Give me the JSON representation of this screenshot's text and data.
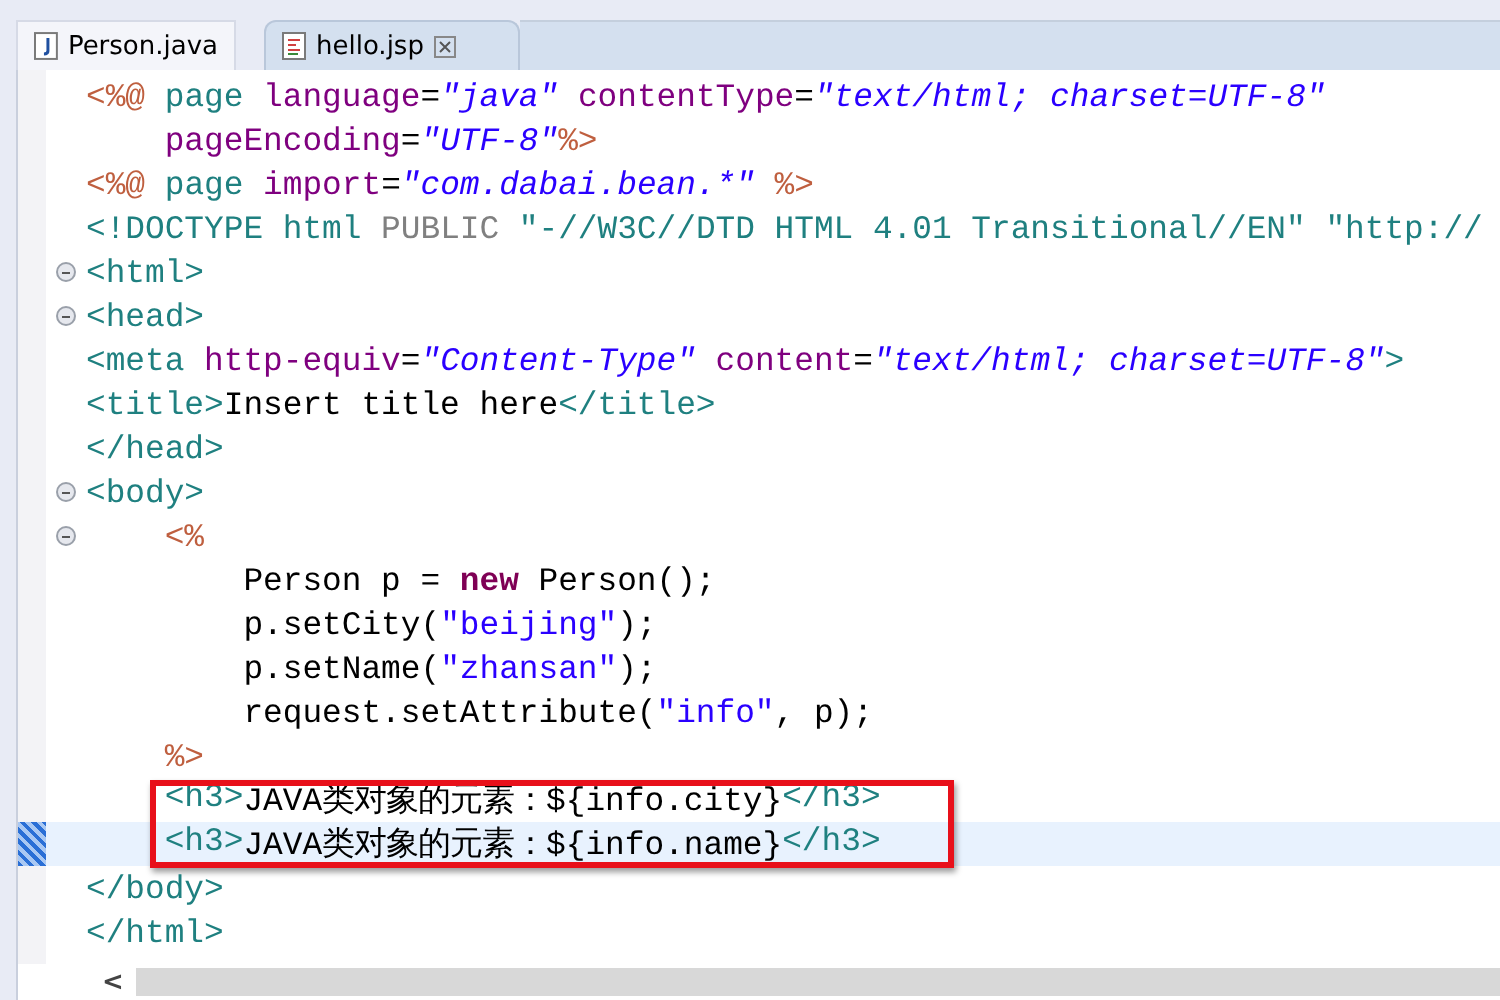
{
  "tabs": [
    {
      "label": "Person.java",
      "kind": "java",
      "selected": false,
      "closable": false
    },
    {
      "label": "hello.jsp",
      "kind": "jsp",
      "selected": true,
      "closable": true
    }
  ],
  "blocks": [
    {
      "boxed": false,
      "lines": [
        {
          "fold_marker": false,
          "current": false,
          "tokens": [
            {
              "kind": "jsp",
              "text": "<%@"
            },
            {
              "kind": "tag",
              "text": " page"
            },
            {
              "kind": "attr",
              "text": " language"
            },
            {
              "kind": "punct",
              "text": "="
            },
            {
              "kind": "value",
              "text": "\"java\""
            },
            {
              "kind": "attr",
              "text": " contentType"
            },
            {
              "kind": "punct",
              "text": "="
            },
            {
              "kind": "value",
              "text": "\"text/html; charset=UTF-8\""
            }
          ]
        },
        {
          "fold_marker": false,
          "current": false,
          "tokens": [
            {
              "kind": "attr",
              "text": "    pageEncoding"
            },
            {
              "kind": "punct",
              "text": "="
            },
            {
              "kind": "value",
              "text": "\"UTF-8\""
            },
            {
              "kind": "jsp",
              "text": "%>"
            }
          ]
        },
        {
          "fold_marker": false,
          "current": false,
          "tokens": [
            {
              "kind": "jsp",
              "text": "<%@"
            },
            {
              "kind": "tag",
              "text": " page"
            },
            {
              "kind": "attr",
              "text": " import"
            },
            {
              "kind": "punct",
              "text": "="
            },
            {
              "kind": "value",
              "text": "\"com.dabai.bean.*\""
            },
            {
              "kind": "jsp",
              "text": " %>"
            }
          ]
        },
        {
          "fold_marker": false,
          "current": false,
          "tokens": [
            {
              "kind": "tag",
              "text": "<!DOCTYPE html"
            },
            {
              "kind": "doctype",
              "text": " PUBLIC"
            },
            {
              "kind": "tag",
              "text": " \"-//W3C//DTD HTML 4.01 Transitional//EN\" \"http://"
            }
          ]
        },
        {
          "fold_marker": true,
          "current": false,
          "tokens": [
            {
              "kind": "tag",
              "text": "<html>"
            }
          ]
        },
        {
          "fold_marker": true,
          "current": false,
          "tokens": [
            {
              "kind": "tag",
              "text": "<head>"
            }
          ]
        },
        {
          "fold_marker": false,
          "current": false,
          "tokens": [
            {
              "kind": "tag",
              "text": "<meta"
            },
            {
              "kind": "attr",
              "text": " http-equiv"
            },
            {
              "kind": "punct",
              "text": "="
            },
            {
              "kind": "value",
              "text": "\"Content-Type\""
            },
            {
              "kind": "attr",
              "text": " content"
            },
            {
              "kind": "punct",
              "text": "="
            },
            {
              "kind": "value",
              "text": "\"text/html; charset=UTF-8\""
            },
            {
              "kind": "tag",
              "text": ">"
            }
          ]
        },
        {
          "fold_marker": false,
          "current": false,
          "tokens": [
            {
              "kind": "tag",
              "text": "<title>"
            },
            {
              "kind": "text",
              "text": "Insert title here"
            },
            {
              "kind": "tag",
              "text": "</title>"
            }
          ]
        },
        {
          "fold_marker": false,
          "current": false,
          "tokens": [
            {
              "kind": "tag",
              "text": "</head>"
            }
          ]
        },
        {
          "fold_marker": true,
          "current": false,
          "tokens": [
            {
              "kind": "tag",
              "text": "<body>"
            }
          ]
        },
        {
          "fold_marker": true,
          "current": false,
          "tokens": [
            {
              "kind": "jsp",
              "text": "    <%"
            }
          ]
        },
        {
          "fold_marker": false,
          "current": false,
          "tokens": [
            {
              "kind": "text",
              "text": "        Person p = "
            },
            {
              "kind": "keyword",
              "text": "new"
            },
            {
              "kind": "text",
              "text": " Person();"
            }
          ]
        },
        {
          "fold_marker": false,
          "current": false,
          "tokens": [
            {
              "kind": "text",
              "text": "        p.setCity("
            },
            {
              "kind": "string",
              "text": "\"beijing\""
            },
            {
              "kind": "text",
              "text": ");"
            }
          ]
        },
        {
          "fold_marker": false,
          "current": false,
          "tokens": [
            {
              "kind": "text",
              "text": "        p.setName("
            },
            {
              "kind": "string",
              "text": "\"zhansan\""
            },
            {
              "kind": "text",
              "text": ");"
            }
          ]
        },
        {
          "fold_marker": false,
          "current": false,
          "tokens": [
            {
              "kind": "text",
              "text": "        request.setAttribute("
            },
            {
              "kind": "string",
              "text": "\"info\""
            },
            {
              "kind": "text",
              "text": ", p);"
            }
          ]
        },
        {
          "fold_marker": false,
          "current": false,
          "tokens": [
            {
              "kind": "jsp",
              "text": "    %>"
            }
          ]
        }
      ]
    },
    {
      "boxed": true,
      "lines": [
        {
          "fold_marker": false,
          "current": false,
          "tokens": [
            {
              "kind": "tag",
              "text": "    <h3>"
            },
            {
              "kind": "text",
              "text": "JAVA类对象的元素：${info.city}"
            },
            {
              "kind": "tag",
              "text": "</h3>"
            }
          ]
        },
        {
          "fold_marker": false,
          "current": true,
          "tokens": [
            {
              "kind": "tag",
              "text": "    <h3>"
            },
            {
              "kind": "text",
              "text": "JAVA类对象的元素：${info.name}"
            },
            {
              "kind": "tag",
              "text": "</h3>"
            }
          ]
        }
      ]
    },
    {
      "boxed": false,
      "lines": [
        {
          "fold_marker": false,
          "current": false,
          "tokens": [
            {
              "kind": "tag",
              "text": "</body>"
            }
          ]
        },
        {
          "fold_marker": false,
          "current": false,
          "tokens": [
            {
              "kind": "tag",
              "text": "</html>"
            }
          ]
        }
      ]
    }
  ],
  "scrollbar": {
    "left_arrow": "<"
  }
}
